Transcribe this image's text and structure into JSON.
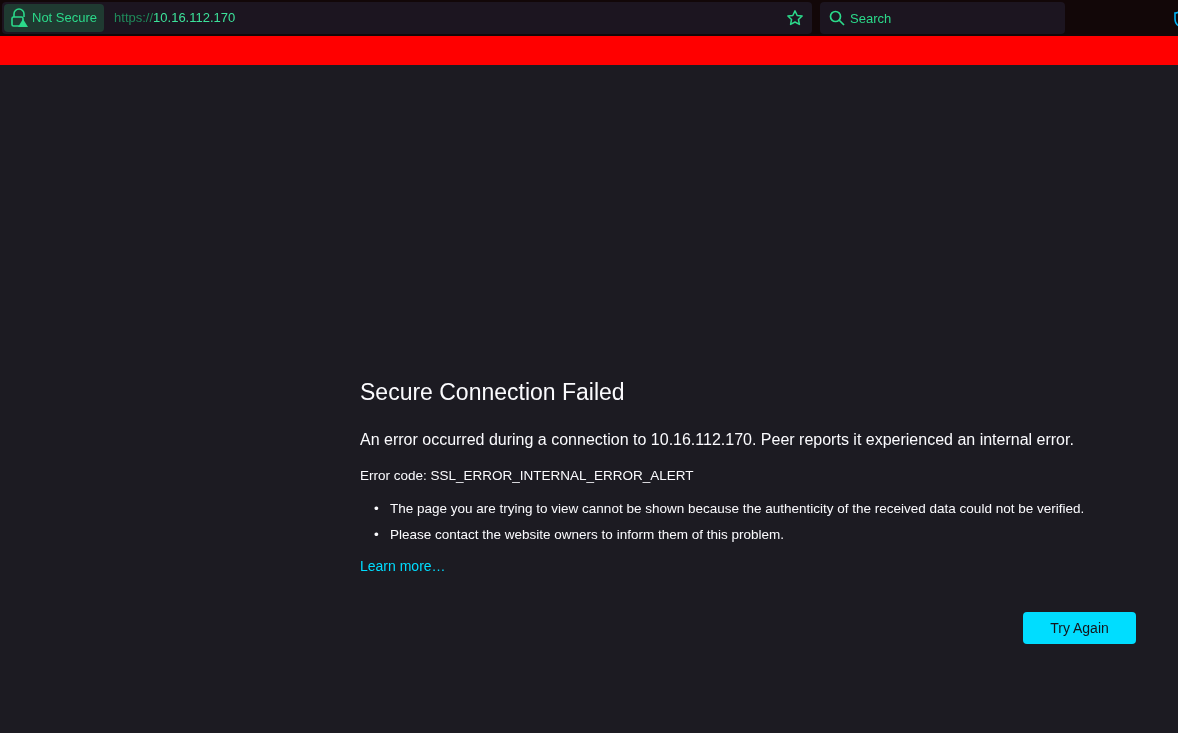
{
  "toolbar": {
    "security_label": "Not Secure",
    "url_scheme": "https://",
    "url_host": "10.16.112.170",
    "search": {
      "placeholder": "Search"
    }
  },
  "banner": {
    "color": "#ff0000"
  },
  "error": {
    "title": "Secure Connection Failed",
    "intro": "An error occurred during a connection to 10.16.112.170. Peer reports it experienced an internal error.",
    "error_code": "Error code: SSL_ERROR_INTERNAL_ERROR_ALERT",
    "bullets": [
      {
        "marker": "•",
        "text": "The page you are trying to view cannot be shown because the authenticity of the received data could not be verified."
      },
      {
        "marker": "•",
        "text": "Please contact the website owners to inform them of this problem."
      }
    ],
    "learn_more": "Learn more…",
    "button": "Try Again"
  }
}
